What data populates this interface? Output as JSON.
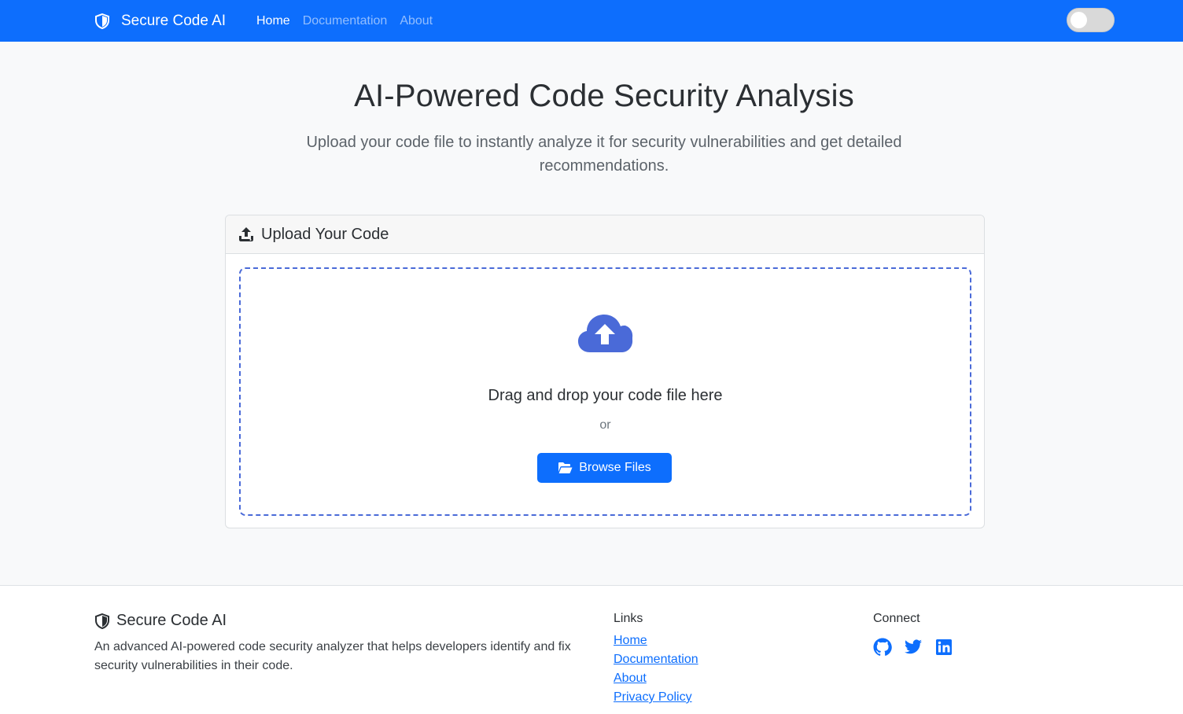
{
  "navbar": {
    "brand": "Secure Code AI",
    "links": [
      {
        "label": "Home",
        "active": true
      },
      {
        "label": "Documentation",
        "active": false
      },
      {
        "label": "About",
        "active": false
      }
    ],
    "theme_toggle_on": false
  },
  "hero": {
    "title": "AI-Powered Code Security Analysis",
    "subtitle": "Upload your code file to instantly analyze it for security vulnerabilities and get detailed recommendations."
  },
  "upload_card": {
    "header": "Upload Your Code",
    "drop_text": "Drag and drop your code file here",
    "or_text": "or",
    "browse_label": "Browse Files"
  },
  "footer": {
    "brand": "Secure Code AI",
    "description": "An advanced AI-powered code security analyzer that helps developers identify and fix security vulnerabilities in their code.",
    "links_title": "Links",
    "links": [
      "Home",
      "Documentation",
      "About",
      "Privacy Policy"
    ],
    "connect_title": "Connect",
    "socials": [
      "github-icon",
      "twitter-icon",
      "linkedin-icon"
    ]
  },
  "colors": {
    "primary": "#0d6efd",
    "dropzone_border": "#4a6ad8",
    "cloud": "#4a6ad8"
  }
}
